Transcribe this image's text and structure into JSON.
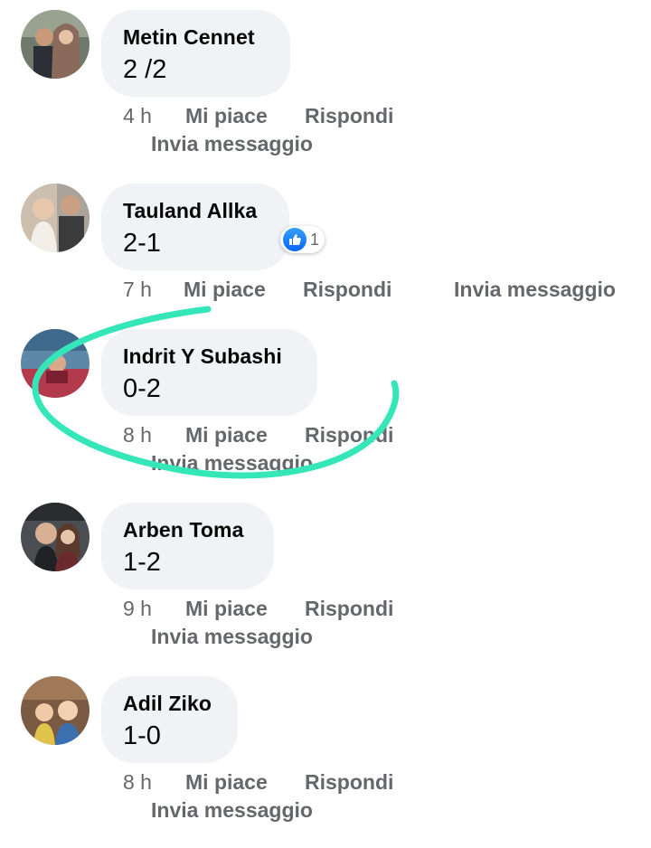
{
  "comments": [
    {
      "author": "Metin Cennet",
      "text": "2 /2",
      "time": "4 h",
      "like_label": "Mi piace",
      "reply_label": "Rispondi",
      "message_label": "Invia messaggio"
    },
    {
      "author": "Tauland Allka",
      "text": "2-1",
      "time": "7 h",
      "like_label": "Mi piace",
      "reply_label": "Rispondi",
      "message_label": "Invia messaggio",
      "reactions": {
        "icon": "thumbs-up-icon",
        "count": "1"
      }
    },
    {
      "author": "Indrit Y Subashi",
      "text": "0-2",
      "time": "8 h",
      "like_label": "Mi piace",
      "reply_label": "Rispondi",
      "message_label": "Invia messaggio"
    },
    {
      "author": "Arben Toma",
      "text": "1-2",
      "time": "9 h",
      "like_label": "Mi piace",
      "reply_label": "Rispondi",
      "message_label": "Invia messaggio"
    },
    {
      "author": "Adil Ziko",
      "text": "1-0",
      "time": "8 h",
      "like_label": "Mi piace",
      "reply_label": "Rispondi",
      "message_label": "Invia messaggio"
    }
  ],
  "colors": {
    "bubble": "#f0f2f5",
    "meta_text": "#65676b",
    "like_blue": "#0866ff",
    "highlight_stroke": "#35e6b8"
  }
}
